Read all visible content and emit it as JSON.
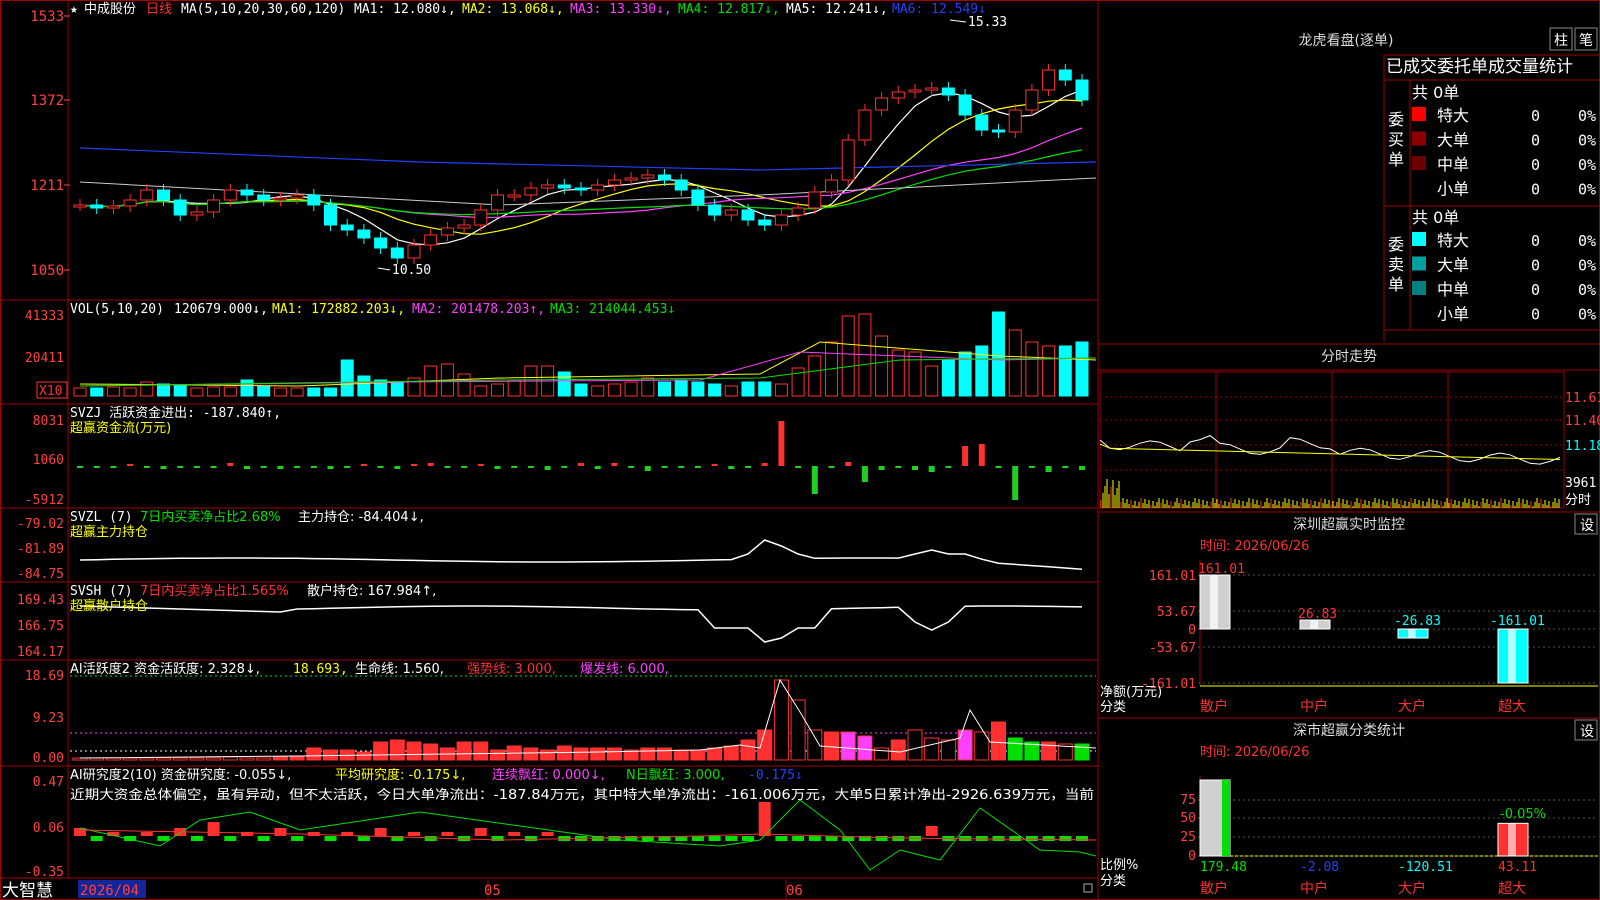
{
  "colors": {
    "up": "#ff3030",
    "down": "#00ffff",
    "frame": "#a00000",
    "axis": "#ff4040",
    "white": "#ffffff",
    "yellow": "#ffff00",
    "magenta": "#ff40ff",
    "green": "#00e000",
    "blue": "#2040ff"
  },
  "header": {
    "star": "★",
    "stock_name": "中成股份",
    "period": "日线",
    "ma_label": "MA(5,10,20,30,60,120)",
    "ma1": "MA1: 12.080↓,",
    "ma2": "MA2: 13.068↓,",
    "ma3": "MA3: 13.330↓,",
    "ma4": "MA4: 12.817↓,",
    "ma5": "MA5: 12.241↓,",
    "ma6": "MA6: 12.549↓",
    "high_mark": "15.33",
    "low_mark": "10.50"
  },
  "price_axis": [
    "1533",
    "1372",
    "1211",
    "1050"
  ],
  "vol": {
    "label": "VOL(5,10,20)",
    "value": "120679.000↓,",
    "ma1": "MA1: 172882.203↓,",
    "ma2": "MA2: 201478.203↑,",
    "ma3": "MA3: 214044.453↓",
    "axis": [
      "41333",
      "20411"
    ],
    "unit": "X10"
  },
  "svzj": {
    "label": "SVZJ  活跃资金进出: -187.840↑,",
    "sub": "超赢资金流(万元)",
    "axis": [
      "8031",
      "1060",
      "-5912"
    ]
  },
  "svzl": {
    "label": "SVZL (7)",
    "label2": "7日内买卖净占比2.68%",
    "label3": "主力持仓: -84.404↓,",
    "sub": "超赢主力持仓",
    "axis": [
      "-79.02",
      "-81.89",
      "-84.75"
    ]
  },
  "svsh": {
    "label": "SVSH (7)",
    "label2": "7日内买卖净占比1.565%",
    "label3": "散户持仓: 167.984↑,",
    "sub": "超赢散户持仓",
    "axis": [
      "169.43",
      "166.75",
      "164.17"
    ]
  },
  "ai1": {
    "label": "AI活跃度2 资金活跃度: 2.328↓,",
    "v2": "18.693,",
    "v3": "生命线: 1.560,",
    "v4": "强势线: 3.000,",
    "v5": "爆发线: 6.000,",
    "axis": [
      "18.69",
      "9.23",
      "0.00"
    ]
  },
  "ai2": {
    "label": "AI研究度2(10) 资金研究度: -0.055↓,",
    "v2": "平均研究度: -0.175↓,",
    "v3": "连续飘红: 0.000↓,",
    "v4": "N日飘红: 3.000,",
    "v5": "-0.175↓",
    "note": "近期大资金总体偏空，虽有异动，但不太活跃，今日大单净流出：-187.84万元，其中特大单净流出：-161.006万元，大单5日累计净出-2926.639万元，当前",
    "axis": [
      "0.47",
      "0.06",
      "-0.35"
    ]
  },
  "bottom": {
    "brand": "大智慧",
    "date1": "2026/04",
    "m1": "05",
    "m2": "06"
  },
  "longhu": {
    "title": "龙虎看盘(逐单)",
    "btn1": "柱",
    "btn2": "笔",
    "header": "已成交委托单成交量统计",
    "buy_total": "共 0单",
    "buy_side": "委买单",
    "sell_total": "共 0单",
    "sell_side": "委卖单",
    "buy_rows": [
      {
        "label": "特大",
        "v": "0",
        "p": "0%"
      },
      {
        "label": "大单",
        "v": "0",
        "p": "0%"
      },
      {
        "label": "中单",
        "v": "0",
        "p": "0%"
      },
      {
        "label": "小单",
        "v": "0",
        "p": "0%"
      }
    ],
    "sell_rows": [
      {
        "label": "特大",
        "v": "0",
        "p": "0%"
      },
      {
        "label": "大单",
        "v": "0",
        "p": "0%"
      },
      {
        "label": "中单",
        "v": "0",
        "p": "0%"
      },
      {
        "label": "小单",
        "v": "0",
        "p": "0%"
      }
    ]
  },
  "intraday": {
    "title": "分时走势",
    "axis": [
      "11.61",
      "11.40",
      "11.18"
    ],
    "vol": "3961",
    "vol_label": "分时"
  },
  "monitor": {
    "title": "深圳超赢实时监控",
    "btn": "设",
    "time": "时间: 2026/06/26",
    "axis": [
      "161.01",
      "53.67",
      "0",
      "-53.67",
      "-161.01"
    ],
    "cats": [
      "散户",
      "中户",
      "大户",
      "超大"
    ],
    "vals": [
      161.01,
      26.83,
      -26.83,
      -161.01
    ],
    "labels": [
      "161.01",
      "26.83",
      "-26.83",
      "-161.01"
    ],
    "ylabel": "净额(万元)",
    "xlabel": "分类"
  },
  "stats": {
    "title": "深市超赢分类统计",
    "btn": "设",
    "time": "时间: 2026/06/26",
    "axis": [
      "75",
      "50",
      "25",
      "0"
    ],
    "cats": [
      "散户",
      "中户",
      "大户",
      "超大"
    ],
    "vals": [
      "179.48",
      "-2.08",
      "-120.51",
      "43.11"
    ],
    "bar_pct": [
      100,
      0,
      0,
      43
    ],
    "top_label": "-0.05%",
    "ylabel": "比例%",
    "xlabel": "分类"
  }
}
